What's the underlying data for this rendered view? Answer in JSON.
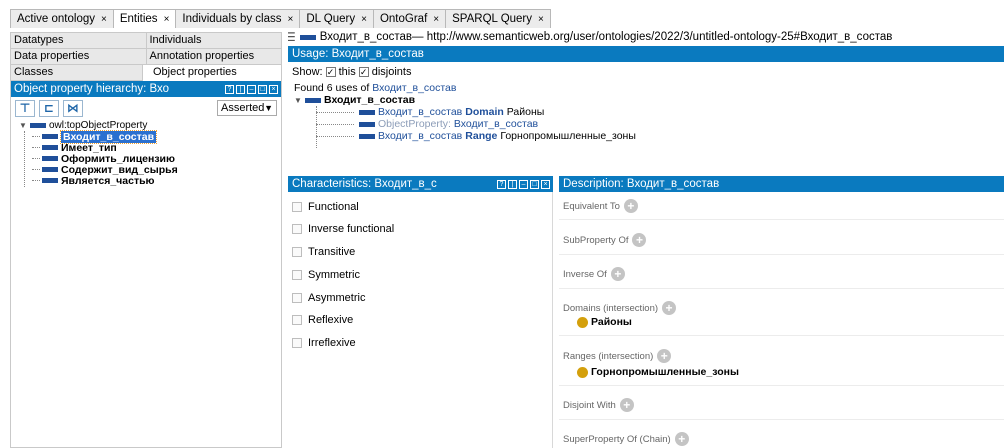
{
  "tabs": [
    {
      "label": "Active ontology",
      "active": false
    },
    {
      "label": "Entities",
      "active": true
    },
    {
      "label": "Individuals by class",
      "active": false
    },
    {
      "label": "DL Query",
      "active": false
    },
    {
      "label": "OntoGraf",
      "active": false
    },
    {
      "label": "SPARQL Query",
      "active": false
    }
  ],
  "tab_close": "×",
  "left": {
    "row1": [
      "Datatypes",
      "Individuals"
    ],
    "row2": [
      "Data properties",
      "Annotation properties"
    ],
    "row3": [
      "Classes",
      "Object properties"
    ],
    "hierarchy_title": "Object property hierarchy: Вхо",
    "asserted": "Asserted",
    "tree_root": "owl:topObjectProperty",
    "tree_items": [
      {
        "label": "Входит_в_состав",
        "selected": true
      },
      {
        "label": "Имеет_тип",
        "selected": false
      },
      {
        "label": "Оформить_лицензию",
        "selected": false
      },
      {
        "label": "Содержит_вид_сырья",
        "selected": false
      },
      {
        "label": "Является_частью",
        "selected": false
      }
    ]
  },
  "header": {
    "entity": "Входит_в_состав",
    "iri": " — http://www.semanticweb.org/user/ontologies/2022/3/untitled-ontology-25#Входит_в_состав"
  },
  "usage": {
    "title": "Usage: Входит_в_состав",
    "show_label": "Show:",
    "this_label": "this",
    "disjoints_label": "disjoints",
    "found_prefix": "Found 6 uses of ",
    "found_entity": "Входит_в_состав",
    "root": "Входит_в_состав",
    "items": [
      {
        "subject": "Входит_в_состав",
        "keyword": "Domain",
        "object": "Районы"
      },
      {
        "prefix": "ObjectProperty:",
        "subject": "Входит_в_состав"
      },
      {
        "subject": "Входит_в_состав",
        "keyword": "Range",
        "object": "Горнопромышленные_зоны"
      }
    ]
  },
  "characteristics": {
    "title": "Characteristics: Входит_в_с",
    "items": [
      "Functional",
      "Inverse functional",
      "Transitive",
      "Symmetric",
      "Asymmetric",
      "Reflexive",
      "Irreflexive"
    ]
  },
  "description": {
    "title": "Description: Входит_в_состав",
    "sections": {
      "equivalent": "Equivalent To",
      "subproperty": "SubProperty Of",
      "inverse": "Inverse Of",
      "domains": "Domains (intersection)",
      "domain_value": "Районы",
      "ranges": "Ranges (intersection)",
      "range_value": "Горнопромышленные_зоны",
      "disjoint": "Disjoint With",
      "superchain": "SuperProperty Of (Chain)"
    }
  },
  "colors": {
    "view_title_bg": "#0a7abf",
    "property_bar": "#1f4f9a",
    "individual_dot": "#d4a00c"
  }
}
